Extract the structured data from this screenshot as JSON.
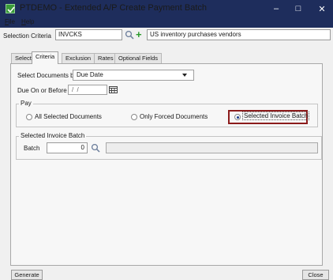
{
  "window": {
    "title": "PTDEMO - Extended A/P Create Payment Batch",
    "minimize_glyph": "–",
    "maximize_glyph": "□",
    "close_glyph": "✕"
  },
  "menu": {
    "file": {
      "mnemonic": "F",
      "rest": "ile"
    },
    "help": {
      "mnemonic": "H",
      "rest": "elp"
    }
  },
  "selection": {
    "label": "Selection Criteria",
    "value": "INVCKS",
    "description": "US inventory purchases vendors"
  },
  "tabs": [
    {
      "label": "Select"
    },
    {
      "label": "Criteria"
    },
    {
      "label": "Exclusion"
    },
    {
      "label": "Rates"
    },
    {
      "label": "Optional Fields"
    }
  ],
  "criteria": {
    "select_docs_label": "Select Documents by",
    "select_docs_value": "Due Date",
    "due_label": "Due On or Before",
    "due_value": "/ /"
  },
  "pay": {
    "title": "Pay",
    "options": [
      {
        "label": "All Selected Documents",
        "selected": false
      },
      {
        "label": "Only Forced Documents",
        "selected": false
      },
      {
        "label": "Selected Invoice Batch",
        "selected": true
      }
    ]
  },
  "batch_group": {
    "title": "Selected Invoice Batch",
    "batch_label": "Batch",
    "batch_value": "0",
    "batch_description": ""
  },
  "buttons": {
    "generate": "Generate",
    "close": "Close"
  },
  "colors": {
    "titlebar": "#1e2d5c",
    "highlight": "#8c1c1c",
    "plus": "#2a9a2a"
  },
  "icons": {
    "app": "app-check-icon",
    "finder": "magnifier-icon",
    "new": "plus-icon",
    "calendar": "calendar-icon"
  }
}
